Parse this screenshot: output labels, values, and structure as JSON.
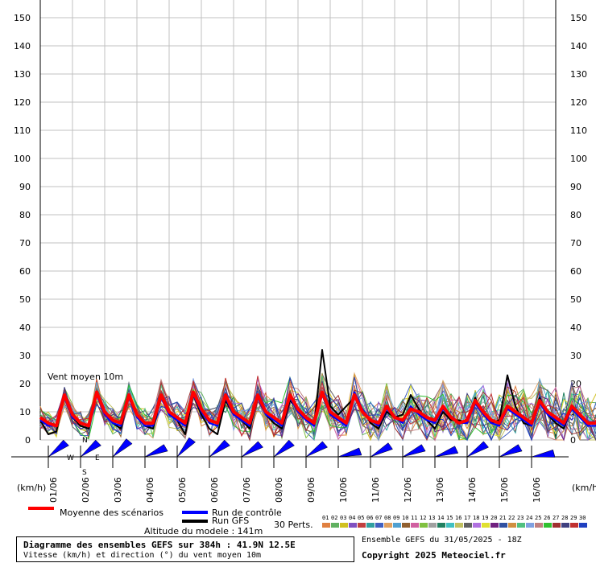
{
  "chart_data": {
    "type": "line",
    "title": "Diagramme des ensembles GEFS sur 384h : 41.9N 12.5E",
    "subtitle": "Vitesse (km/h) et direction (°) du vent moyen 10m",
    "in_plot_label": "Vent moyen 10m",
    "ylabel": "(km/h)",
    "ylim": [
      0,
      150
    ],
    "yticks": [
      0,
      10,
      20,
      30,
      40,
      50,
      60,
      70,
      80,
      90,
      100,
      110,
      120,
      130,
      140,
      150
    ],
    "x_dates": [
      "01/06",
      "02/06",
      "03/06",
      "04/06",
      "05/06",
      "06/06",
      "07/06",
      "08/06",
      "09/06",
      "10/06",
      "11/06",
      "12/06",
      "13/06",
      "14/06",
      "15/06",
      "16/06"
    ],
    "steps_per_day": 4,
    "grid": true,
    "series": [
      {
        "name": "Moyenne des scénarios",
        "color": "#ff0000",
        "values": [
          8,
          6,
          5,
          16,
          9,
          6,
          5,
          17,
          10,
          7,
          6,
          16,
          9,
          6,
          6,
          16,
          10,
          8,
          6,
          17,
          11,
          7,
          6,
          16,
          10,
          8,
          6,
          16,
          10,
          8,
          6,
          16,
          11,
          8,
          6,
          17,
          10,
          8,
          6,
          16,
          10,
          7,
          6,
          12,
          8,
          7,
          11,
          10,
          8,
          7,
          12,
          8,
          6,
          7,
          14,
          10,
          7,
          6,
          12,
          10,
          8,
          6,
          14,
          10,
          8,
          6,
          12,
          9,
          6,
          6,
          12,
          8,
          6,
          6,
          13,
          9
        ]
      },
      {
        "name": "Run de contrôle",
        "color": "#0000ff",
        "values": [
          7,
          5,
          5,
          15,
          8,
          6,
          5,
          16,
          9,
          6,
          5,
          15,
          8,
          5,
          5,
          15,
          9,
          7,
          5,
          16,
          10,
          6,
          5,
          15,
          9,
          7,
          5,
          15,
          9,
          7,
          5,
          15,
          10,
          7,
          5,
          16,
          9,
          7,
          5,
          17,
          11,
          7,
          5,
          11,
          8,
          6,
          12,
          9,
          7,
          6,
          11,
          8,
          6,
          6,
          13,
          9,
          6,
          5,
          11,
          9,
          7,
          5,
          13,
          9,
          7,
          5,
          11,
          8,
          5,
          5,
          11,
          7,
          5,
          5,
          12,
          8
        ]
      },
      {
        "name": "Run GFS",
        "color": "#000000",
        "values": [
          7,
          2,
          3,
          16,
          8,
          5,
          4,
          17,
          10,
          6,
          4,
          16,
          9,
          5,
          4,
          15,
          10,
          7,
          2,
          16,
          9,
          4,
          2,
          14,
          9,
          7,
          4,
          15,
          9,
          6,
          4,
          14,
          11,
          8,
          5,
          32,
          12,
          9,
          12,
          15,
          11,
          6,
          4,
          10,
          8,
          9,
          16,
          11,
          7,
          4,
          10,
          7,
          7,
          6,
          15,
          9,
          6,
          7,
          23,
          12,
          6,
          5,
          15,
          9,
          6,
          4,
          12,
          8,
          5,
          5,
          13,
          8,
          6,
          5,
          15,
          10
        ]
      }
    ],
    "perturbations_label": "30 Perts.",
    "perturbation_ids": [
      "01",
      "02",
      "03",
      "04",
      "05",
      "06",
      "07",
      "08",
      "09",
      "10",
      "11",
      "12",
      "13",
      "14",
      "15",
      "16",
      "17",
      "18",
      "19",
      "20",
      "21",
      "22",
      "23",
      "24",
      "25",
      "26",
      "27",
      "28",
      "29",
      "30"
    ],
    "perturbation_colors": [
      "#e08040",
      "#60b060",
      "#d0c020",
      "#8050c0",
      "#c04040",
      "#30a0a0",
      "#4060c0",
      "#e0a060",
      "#50a0d0",
      "#906030",
      "#d060a0",
      "#80c040",
      "#a0a0a0",
      "#208060",
      "#40c0c0",
      "#c0c060",
      "#606060",
      "#b070e0",
      "#e0e030",
      "#702080",
      "#3050a0",
      "#d09040",
      "#50c080",
      "#80a0e0",
      "#c08080",
      "#30c030",
      "#a03030",
      "#404080",
      "#c03030",
      "#2040c0"
    ],
    "wind_dir_deg": [
      225,
      225,
      220,
      240,
      215,
      225,
      230,
      225,
      230,
      250,
      235,
      240,
      245,
      230,
      240,
      255
    ]
  },
  "legend": {
    "mean_label": "Moyenne des scénarios",
    "control_label": "Run de contrôle",
    "gfs_label": "Run GFS",
    "altitude_text": "Altitude du modele : 141m"
  },
  "compass": {
    "n": "N",
    "s": "S",
    "e": "E",
    "w": "W"
  },
  "footer": {
    "run_info": "Ensemble GEFS du 31/05/2025 - 18Z",
    "copyright": "Copyright 2025 Meteociel.fr"
  },
  "colors": {
    "mean": "#ff0000",
    "control": "#0000ff",
    "gfs": "#000000",
    "grid": "#c0c0c0",
    "arrows": "#0000ff"
  }
}
